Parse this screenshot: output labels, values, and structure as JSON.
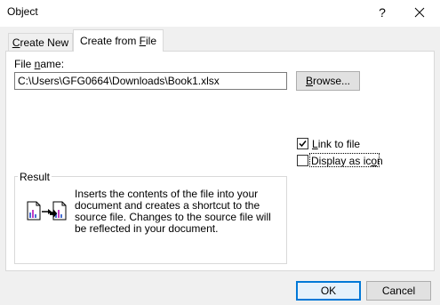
{
  "window": {
    "title": "Object",
    "help": "?"
  },
  "tabs": [
    {
      "label_before": "",
      "underline": "C",
      "label_after": "reate New",
      "active": false
    },
    {
      "label_before": "Create from ",
      "underline": "F",
      "label_after": "ile",
      "active": true
    }
  ],
  "file_name": {
    "label_before": "File ",
    "underline": "n",
    "label_after": "ame:",
    "value": "C:\\Users\\GFG0664\\Downloads\\Book1.xlsx"
  },
  "browse": {
    "underline": "B",
    "label_after": "rowse..."
  },
  "options": {
    "link": {
      "underline": "L",
      "label_after": "ink to file",
      "checked": true
    },
    "display_icon": {
      "label_before": "Display as ic",
      "underline": "o",
      "label_after": "n",
      "checked": false
    }
  },
  "result": {
    "legend": "Result",
    "text": "Inserts the contents of the file into your document and creates a shortcut to the source file.  Changes to the source file will be reflected in your document."
  },
  "buttons": {
    "ok": "OK",
    "cancel": "Cancel"
  },
  "colors": {
    "dialog_bg": "#f0f0f0",
    "accent": "#0078d7",
    "button_bg": "#e1e1e1"
  }
}
